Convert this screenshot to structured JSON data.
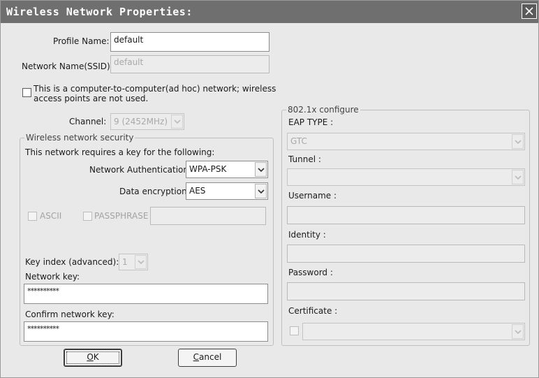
{
  "window": {
    "title": "Wireless Network Properties:"
  },
  "profile": {
    "label": "Profile Name:",
    "value": "default"
  },
  "ssid": {
    "label": "Network Name(SSID):",
    "value": "default"
  },
  "adhoc": {
    "line1": "This is a computer-to-computer(ad hoc) network; wireless",
    "line2": "access points are not used."
  },
  "channel": {
    "label": "Channel:",
    "value": "9  (2452MHz)"
  },
  "security": {
    "legend": "Wireless network security",
    "requires": "This network requires a key for the following:",
    "auth_label": "Network Authentication:",
    "auth_value": "WPA-PSK",
    "enc_label": "Data encryption:",
    "enc_value": "AES",
    "ascii_label": "ASCII",
    "passphrase_label": "PASSPHRASE",
    "keyindex_label": "Key index (advanced):",
    "keyindex_value": "1",
    "netkey_label": "Network key:",
    "netkey_value": "**********",
    "confirm_label": "Confirm network key:",
    "confirm_value": "**********"
  },
  "eap": {
    "legend": "802.1x configure",
    "type_label": "EAP TYPE :",
    "type_value": "GTC",
    "tunnel_label": "Tunnel :",
    "username_label": "Username :",
    "identity_label": "Identity :",
    "password_label": "Password :",
    "certificate_label": "Certificate :"
  },
  "buttons": {
    "ok_underlined": "O",
    "ok_rest": "K",
    "cancel_underlined": "C",
    "cancel_rest": "ancel"
  },
  "icons": {
    "close": "close-icon",
    "dropdown": "chevron-down-icon"
  }
}
